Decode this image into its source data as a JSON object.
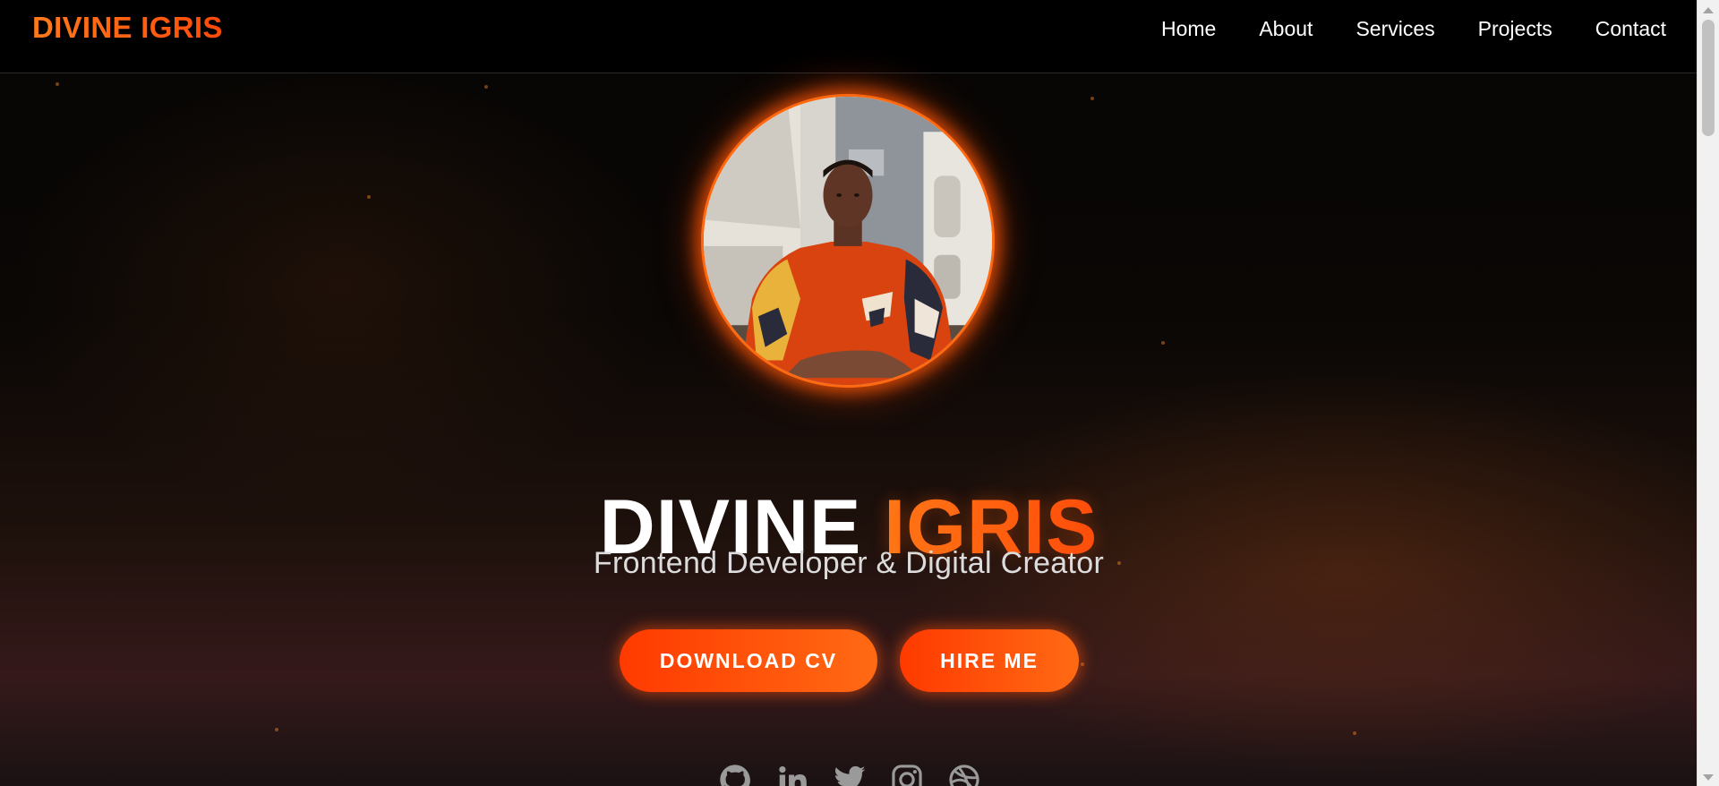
{
  "navbar": {
    "logo": "DIVINE IGRIS",
    "links": [
      "Home",
      "About",
      "Services",
      "Projects",
      "Contact"
    ]
  },
  "hero": {
    "avatar_alt": "Profile photo",
    "title_first": "DIVINE",
    "title_last": "IGRIS",
    "subtitle": "Frontend Developer & Digital Creator",
    "buttons": {
      "download_cv": "DOWNLOAD CV",
      "hire_me": "HIRE ME"
    },
    "socials": [
      "github-icon",
      "linkedin-icon",
      "twitter-icon",
      "instagram-icon",
      "dribbble-icon"
    ]
  },
  "colors": {
    "accent": "#ff5a0f",
    "accent_light": "#ff7d1a",
    "background": "#0a0705",
    "text": "#ffffff",
    "subtitle": "#dcdcdc",
    "icons": "#9a9a9a"
  }
}
